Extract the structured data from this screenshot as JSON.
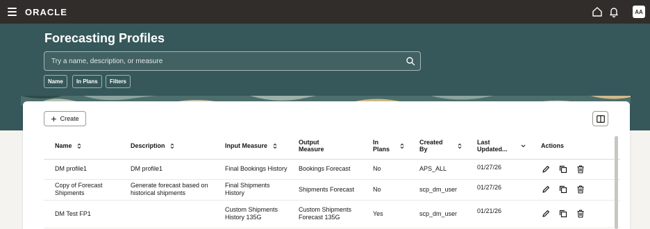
{
  "header": {
    "brand": "ORACLE",
    "avatar_initials": "AA",
    "icons": [
      "hamburger-icon",
      "home-icon",
      "notifications-icon"
    ]
  },
  "page": {
    "title": "Forecasting Profiles",
    "search_placeholder": "Try a name, description, or measure",
    "filter_chips": [
      "Name",
      "In Plans",
      "Filters"
    ]
  },
  "toolbar": {
    "create_label": "Create"
  },
  "table": {
    "columns": [
      {
        "label": "Name",
        "sortable": true
      },
      {
        "label": "Description",
        "sortable": true
      },
      {
        "label": "Input Measure",
        "sortable": true
      },
      {
        "label": "Output Measure",
        "sortable": false
      },
      {
        "label": "In Plans",
        "sortable": true
      },
      {
        "label": "Created By",
        "sortable": true
      },
      {
        "label": "Last Updated...",
        "sortable": "desc"
      },
      {
        "label": "Actions",
        "sortable": false
      }
    ],
    "rows": [
      {
        "name": "DM profile1",
        "description": "DM profile1",
        "input_measure": "Final Bookings History",
        "output_measure": "Bookings Forecast",
        "in_plans": "No",
        "created_by": "APS_ALL",
        "last_updated": "01/27/26"
      },
      {
        "name": "Copy of Forecast Shipments",
        "description": "Generate forecast based on historical shipments",
        "input_measure": "Final Shipments History",
        "output_measure": "Shipments Forecast",
        "in_plans": "No",
        "created_by": "scp_dm_user",
        "last_updated": "01/27/26"
      },
      {
        "name": "DM Test FP1",
        "description": "",
        "input_measure": "Custom Shipments History 135G",
        "output_measure": "Custom Shipments Forecast 135G",
        "in_plans": "Yes",
        "created_by": "scp_dm_user",
        "last_updated": "01/21/26"
      }
    ],
    "row_actions": [
      "edit-icon",
      "duplicate-icon",
      "delete-icon"
    ]
  },
  "colors": {
    "topbar": "#312d2a",
    "hero": "#36585a",
    "link": "#227e9e"
  }
}
